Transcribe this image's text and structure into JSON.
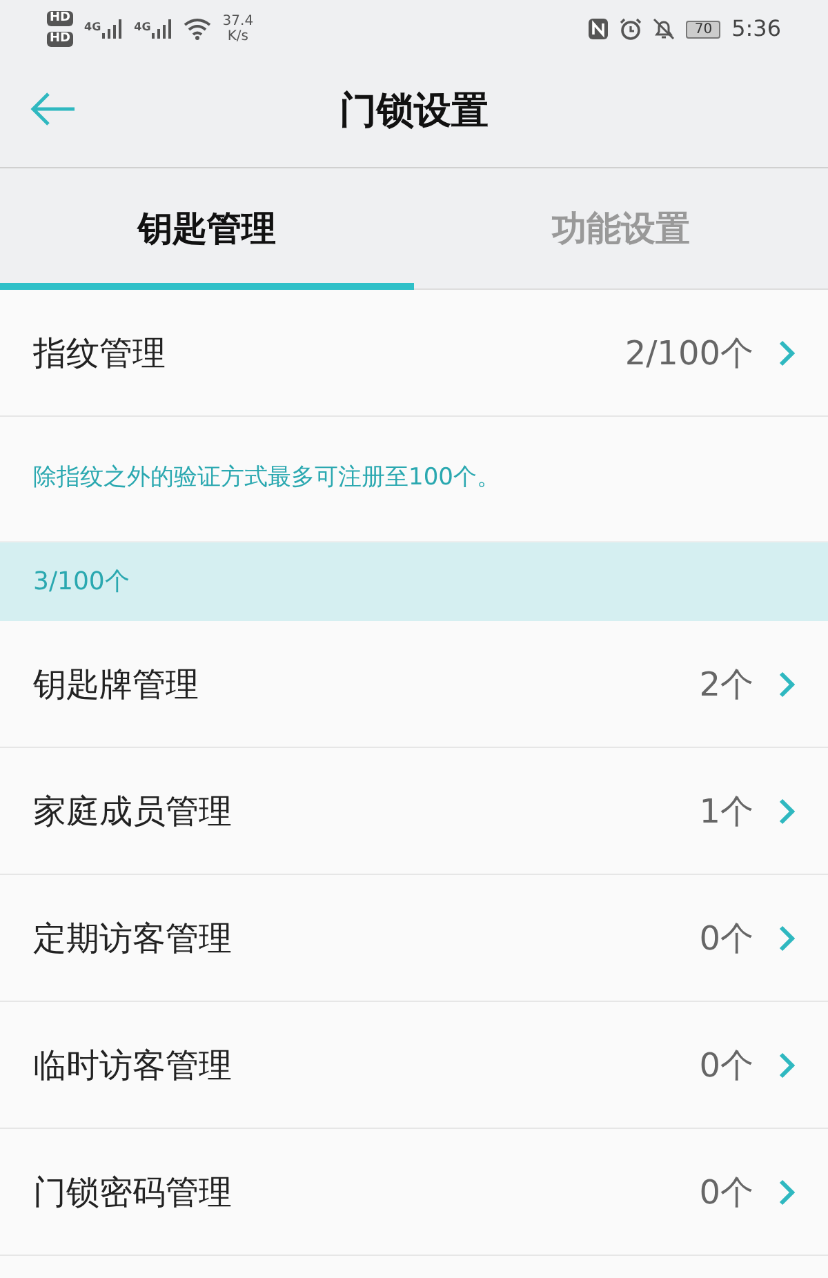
{
  "status_bar": {
    "hd_badges": [
      "HD",
      "HD"
    ],
    "networks": [
      "4G",
      "4G"
    ],
    "speed_value": "37.4",
    "speed_unit": "K/s",
    "battery": "70",
    "time": "5:36"
  },
  "header": {
    "title": "门锁设置"
  },
  "tabs": [
    {
      "label": "钥匙管理",
      "selected": true
    },
    {
      "label": "功能设置",
      "selected": false
    }
  ],
  "fingerprint": {
    "label": "指纹管理",
    "count": "2/100个"
  },
  "note": "除指纹之外的验证方式最多可注册至100个。",
  "section": "3/100个",
  "items": [
    {
      "label": "钥匙牌管理",
      "count": "2个"
    },
    {
      "label": "家庭成员管理",
      "count": "1个"
    },
    {
      "label": "定期访客管理",
      "count": "0个"
    },
    {
      "label": "临时访客管理",
      "count": "0个"
    },
    {
      "label": "门锁密码管理",
      "count": "0个"
    }
  ]
}
